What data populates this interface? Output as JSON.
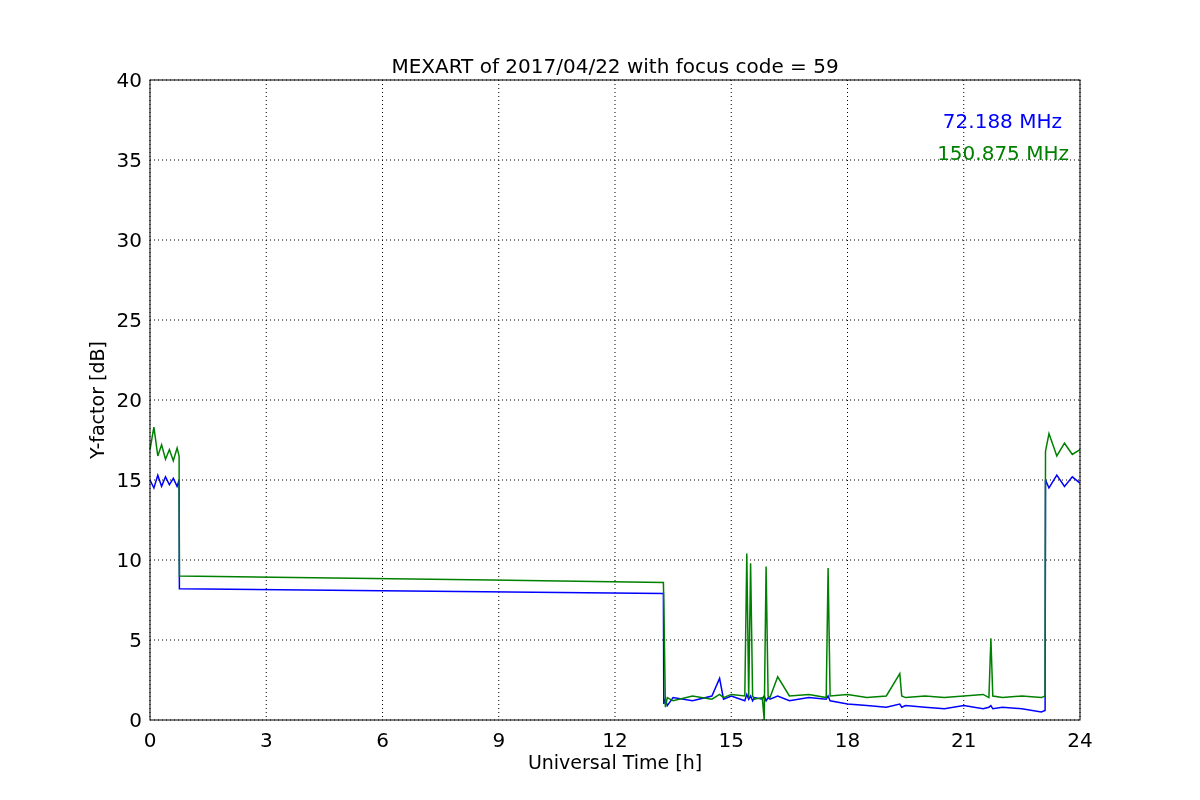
{
  "figure": {
    "chart_data": {
      "type": "line",
      "title": "MEXART of 2017/04/22 with focus code = 59",
      "xlabel": "Universal Time [h]",
      "ylabel": "Y-factor [dB]",
      "xlim": [
        0,
        24
      ],
      "ylim": [
        0,
        40
      ],
      "xticks": [
        0,
        3,
        6,
        9,
        12,
        15,
        18,
        21,
        24
      ],
      "yticks": [
        0,
        5,
        10,
        15,
        20,
        25,
        30,
        35,
        40
      ],
      "grid": true,
      "x": [
        0,
        0.1,
        0.2,
        0.3,
        0.4,
        0.5,
        0.6,
        0.7,
        0.75,
        0.76,
        13.25,
        13.26,
        13.3,
        13.35,
        13.5,
        14,
        14.5,
        14.7,
        14.8,
        15,
        15.35,
        15.4,
        15.45,
        15.5,
        15.55,
        15.6,
        15.8,
        15.85,
        15.9,
        15.95,
        16,
        16.2,
        16.5,
        17,
        17.45,
        17.5,
        17.55,
        18,
        18.5,
        19,
        19.35,
        19.4,
        19.5,
        20,
        20.5,
        21,
        21.5,
        21.65,
        21.7,
        21.75,
        22,
        22.5,
        23,
        23.1,
        23.11,
        23.2,
        23.4,
        23.6,
        23.8,
        24
      ],
      "series": [
        {
          "name": "72.188 MHz",
          "color": "#0000ff",
          "values": [
            15,
            14.5,
            15.3,
            14.6,
            15.2,
            14.7,
            15.1,
            14.6,
            15,
            8.2,
            7.9,
            1.0,
            1.3,
            0.9,
            1.4,
            1.2,
            1.5,
            2.6,
            1.3,
            1.5,
            1.2,
            1.6,
            1.3,
            1.5,
            1.2,
            1.4,
            1.3,
            1.5,
            1.2,
            1.4,
            1.3,
            1.5,
            1.2,
            1.4,
            1.3,
            1.5,
            1.2,
            1.0,
            0.9,
            0.8,
            1.0,
            0.8,
            0.9,
            0.8,
            0.7,
            0.9,
            0.7,
            0.8,
            0.9,
            0.7,
            0.8,
            0.7,
            0.5,
            0.6,
            15,
            14.5,
            15.3,
            14.6,
            15.2,
            14.8
          ]
        },
        {
          "name": "150.875 MHz",
          "color": "#008000",
          "values": [
            16.9,
            18.3,
            16.5,
            17.2,
            16.3,
            16.9,
            16.2,
            17,
            16.5,
            9.0,
            8.6,
            7.4,
            0.8,
            1.4,
            1.2,
            1.5,
            1.3,
            1.6,
            1.4,
            1.6,
            1.5,
            10.4,
            1.4,
            9.8,
            1.5,
            1.3,
            1.4,
            0,
            9.6,
            1.5,
            1.4,
            2.7,
            1.5,
            1.6,
            1.4,
            9.5,
            1.5,
            1.6,
            1.4,
            1.5,
            2.9,
            1.5,
            1.4,
            1.5,
            1.4,
            1.5,
            1.6,
            1.4,
            5.1,
            1.5,
            1.4,
            1.5,
            1.4,
            1.5,
            16.8,
            17.9,
            16.5,
            17.3,
            16.6,
            16.9
          ]
        }
      ]
    }
  }
}
